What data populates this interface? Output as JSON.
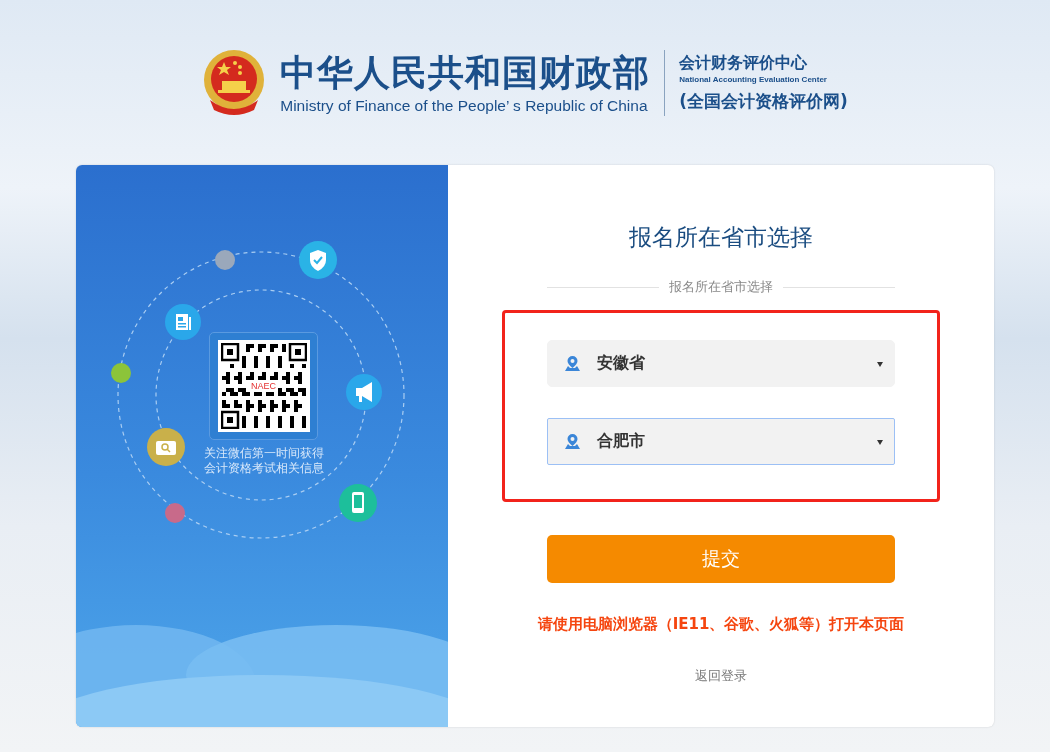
{
  "header": {
    "title_cn": "中华人民共和国财政部",
    "title_en": "Ministry of Finance of the People’ s Republic of China",
    "center_cn": "会计财务评价中心",
    "center_en": "National Accounting Evaluation Center",
    "site_name": "(全国会计资格评价网)"
  },
  "promo": {
    "qr_label": "NAEC",
    "caption": [
      "关注微信第一时间获得",
      "会计资格考试相关信息"
    ]
  },
  "form": {
    "title": "报名所在省市选择",
    "subtitle": "报名所在省市选择",
    "selects": [
      {
        "value": "安徽省",
        "focused": false
      },
      {
        "value": "合肥市",
        "focused": true
      }
    ],
    "submit": "提交",
    "notice": "请使用电脑浏览器（IE11、谷歌、火狐等）打开本页面",
    "back_link": "返回登录"
  }
}
